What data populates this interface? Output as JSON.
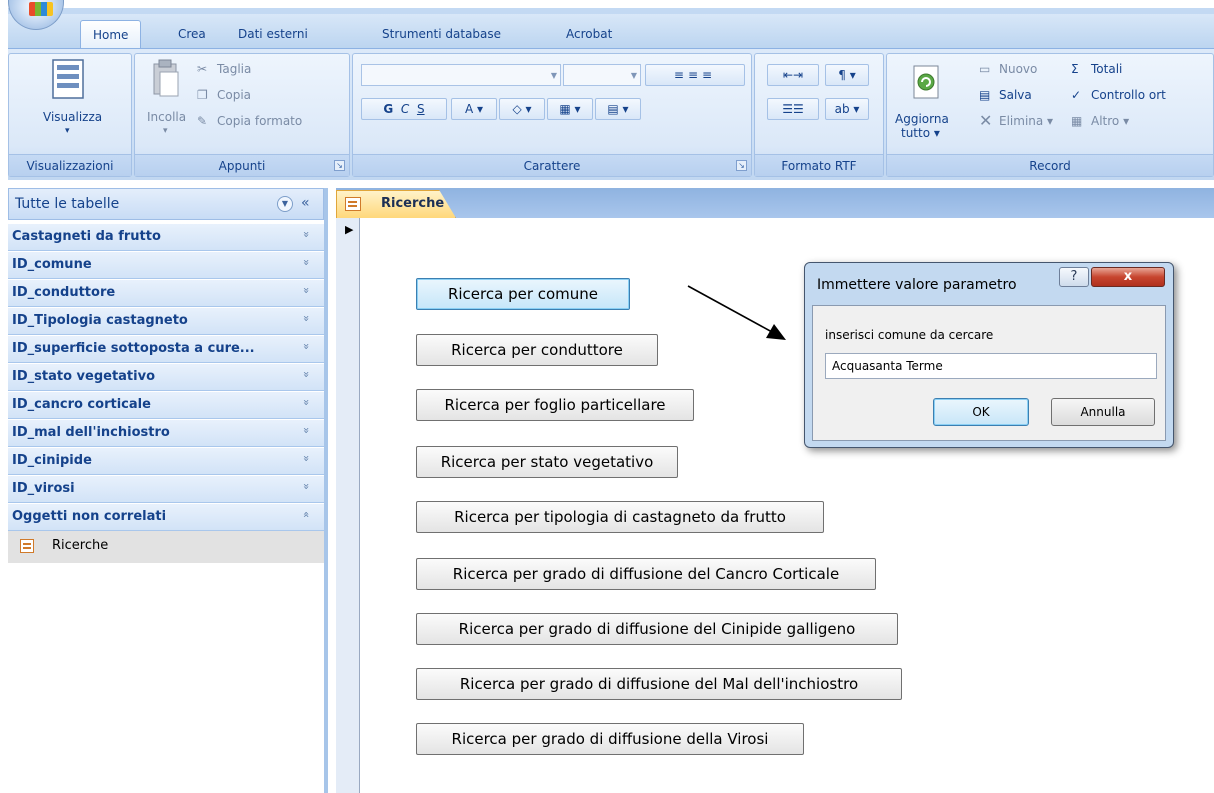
{
  "ribbon": {
    "tabs": [
      {
        "label": "Home",
        "active": true
      },
      {
        "label": "Crea"
      },
      {
        "label": "Dati esterni"
      },
      {
        "label": "Strumenti database"
      },
      {
        "label": "Acrobat"
      }
    ],
    "groups": {
      "visualizzazioni": {
        "label": "Visualizzazioni",
        "visualizza": "Visualizza"
      },
      "appunti": {
        "label": "Appunti",
        "incolla": "Incolla",
        "taglia": "Taglia",
        "copia": "Copia",
        "copia_formato": "Copia formato"
      },
      "carattere": {
        "label": "Carattere",
        "bold": "G",
        "italic": "C",
        "underline": "S",
        "font_color": "A"
      },
      "formato_rtf": {
        "label": "Formato RTF"
      },
      "aggiorna": {
        "line1": "Aggiorna",
        "line2": "tutto ▾"
      },
      "record": {
        "label": "Record",
        "nuovo": "Nuovo",
        "salva": "Salva",
        "elimina": "Elimina",
        "totali": "Totali",
        "controllo": "Controllo ort",
        "altro": "Altro"
      }
    }
  },
  "nav": {
    "title": "Tutte le tabelle",
    "groups": [
      {
        "label": "Castagneti da frutto",
        "chevron": "»"
      },
      {
        "label": "ID_comune",
        "chevron": "»"
      },
      {
        "label": "ID_conduttore",
        "chevron": "»"
      },
      {
        "label": "ID_Tipologia castagneto",
        "chevron": "»"
      },
      {
        "label": "ID_superficie sottoposta a cure...",
        "chevron": "»"
      },
      {
        "label": "ID_stato vegetativo",
        "chevron": "»"
      },
      {
        "label": "ID_cancro corticale",
        "chevron": "»"
      },
      {
        "label": "ID_mal dell'inchiostro",
        "chevron": "»"
      },
      {
        "label": "ID_cinipide",
        "chevron": "»"
      },
      {
        "label": "ID_virosi",
        "chevron": "»"
      },
      {
        "label": "Oggetti non correlati",
        "chevron": "«"
      }
    ],
    "item": "Ricerche"
  },
  "document": {
    "tab_label": "Ricerche",
    "buttons": [
      "Ricerca per comune",
      "Ricerca per conduttore",
      "Ricerca per foglio particellare",
      "Ricerca per stato vegetativo",
      "Ricerca per tipologia di castagneto da frutto",
      "Ricerca per grado di diffusione del Cancro Corticale",
      "Ricerca per grado di diffusione del Cinipide galligeno",
      "Ricerca per grado di diffusione del Mal dell'inchiostro",
      "Ricerca per grado di diffusione della Virosi"
    ]
  },
  "dialog": {
    "title": "Immettere valore parametro",
    "help": "?",
    "close": "x",
    "prompt": "inserisci comune da cercare",
    "value": "Acquasanta Terme",
    "ok": "OK",
    "cancel": "Annulla"
  },
  "colors": {
    "ribbon_bg": "#d0e2f7",
    "ribbon_text": "#15428b",
    "doc_tab": "#ffd87b",
    "dialog_close": "#c7452f"
  }
}
